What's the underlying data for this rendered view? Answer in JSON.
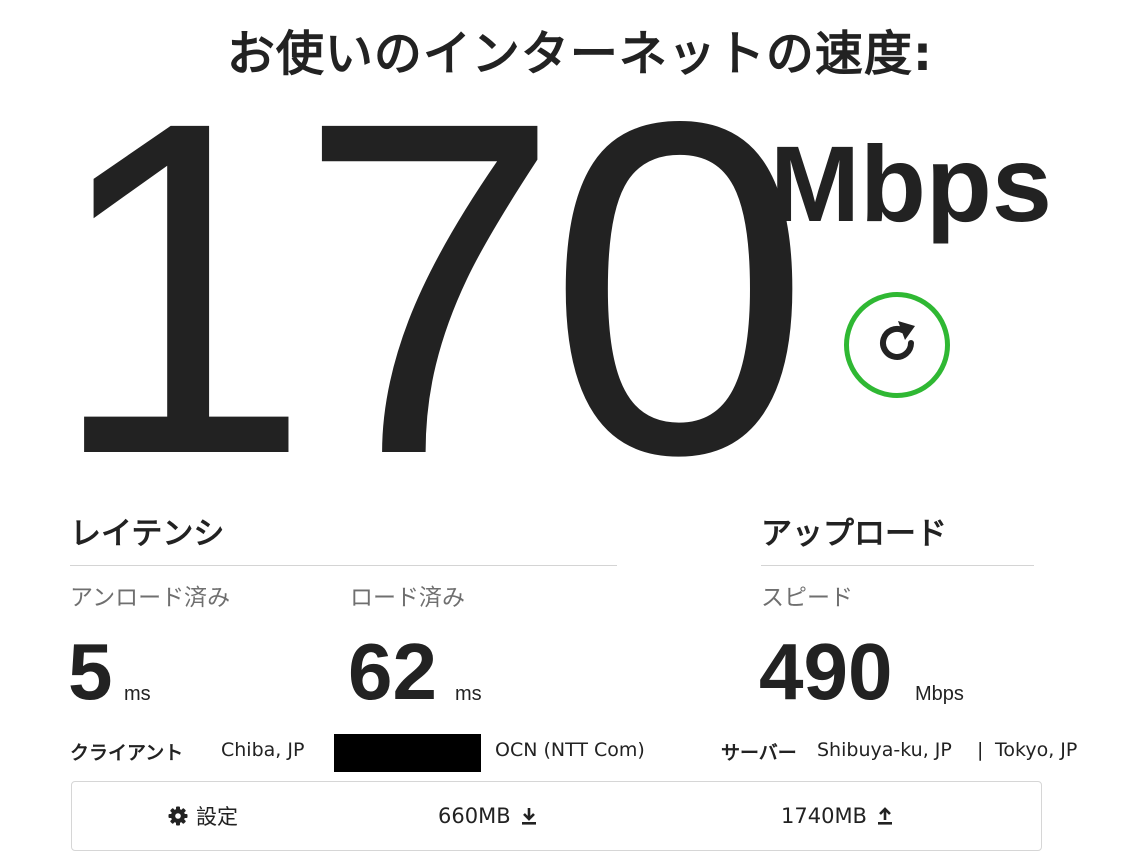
{
  "title": "お使いのインターネットの速度:",
  "speed": {
    "value": "170",
    "unit": "Mbps"
  },
  "reload": {
    "icon": "reload-icon",
    "ring_color": "#2fb833"
  },
  "latency": {
    "title": "レイテンシ",
    "unloaded": {
      "label": "アンロード済み",
      "value": "5",
      "unit": "ms"
    },
    "loaded": {
      "label": "ロード済み",
      "value": "62",
      "unit": "ms"
    }
  },
  "upload": {
    "title": "アップロード",
    "speed": {
      "label": "スピード",
      "value": "490",
      "unit": "Mbps"
    }
  },
  "client": {
    "label": "クライアント",
    "location": "Chiba, JP",
    "isp": "OCN (NTT Com)"
  },
  "server": {
    "label": "サーバー",
    "location": "Shibuya-ku, JP",
    "separator": "|",
    "location2": "Tokyo, JP"
  },
  "footer": {
    "settings": {
      "icon": "gear-icon",
      "label": "設定"
    },
    "download": {
      "value": "660MB",
      "icon": "download-arrow-icon"
    },
    "upload": {
      "value": "1740MB",
      "icon": "upload-arrow-icon"
    }
  }
}
